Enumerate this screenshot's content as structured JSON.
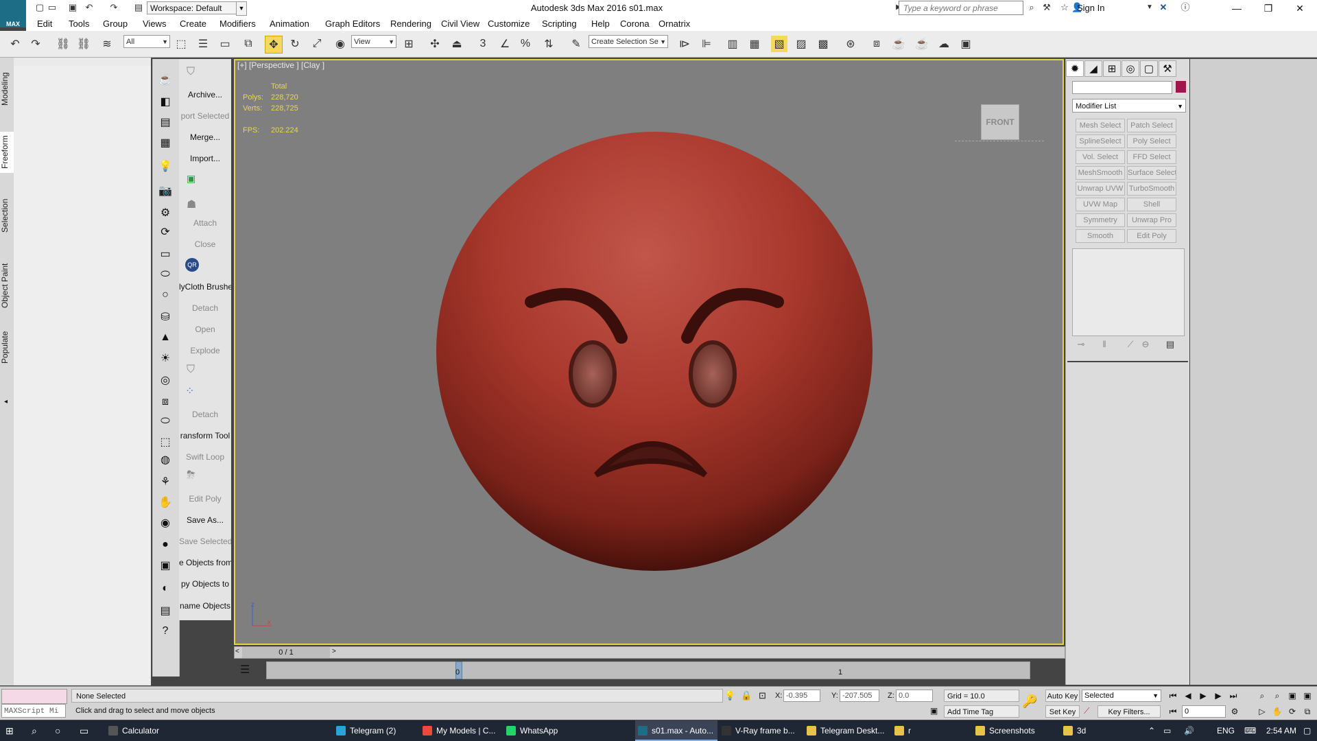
{
  "window": {
    "app_button_label": "MAX",
    "workspace": "Workspace: Default",
    "title": "Autodesk 3ds Max 2016      s01.max",
    "search_placeholder": "Type a keyword or phrase",
    "sign_in": "Sign In"
  },
  "menu": [
    "Edit",
    "Tools",
    "Group",
    "Views",
    "Create",
    "Modifiers",
    "Animation",
    "Graph Editors",
    "Rendering",
    "Civil View",
    "Customize",
    "Scripting",
    "Help",
    "Corona",
    "Ornatrix"
  ],
  "toolbar": {
    "filter": "All",
    "ref_coord": "View",
    "selection_set": "Create Selection Se"
  },
  "left_tabs": [
    "Modeling",
    "Freeform",
    "Selection",
    "Object Paint",
    "Populate"
  ],
  "command_labels": [
    {
      "text": "Archive...",
      "dim": false
    },
    {
      "text": "port Selected",
      "dim": true
    },
    {
      "text": "Merge...",
      "dim": false
    },
    {
      "text": "Import...",
      "dim": false
    },
    {
      "text": "Attach",
      "dim": true
    },
    {
      "text": "Close",
      "dim": true
    },
    {
      "text": "lyCloth Brushe",
      "dim": false
    },
    {
      "text": "Detach",
      "dim": true
    },
    {
      "text": "Open",
      "dim": true
    },
    {
      "text": "Explode",
      "dim": true
    },
    {
      "text": "Detach",
      "dim": true
    },
    {
      "text": "ransform Tool",
      "dim": false
    },
    {
      "text": "Swift Loop",
      "dim": true
    },
    {
      "text": "Edit Poly",
      "dim": true
    },
    {
      "text": "Save As...",
      "dim": false
    },
    {
      "text": "Save Selected",
      "dim": true
    },
    {
      "text": "e Objects from",
      "dim": false
    },
    {
      "text": "py Objects to",
      "dim": false
    },
    {
      "text": "name Objects",
      "dim": false
    }
  ],
  "viewport": {
    "label": "[+] [Perspective ] [Clay ]",
    "stats_header": "Total",
    "polys_label": "Polys:",
    "polys": "228,720",
    "verts_label": "Verts:",
    "verts": "228,725",
    "fps_label": "FPS:",
    "fps": "202.224",
    "viewcube": "FRONT",
    "axis_z": "z",
    "axis_x": "x"
  },
  "command_panel": {
    "modifier_list": "Modifier List",
    "swatch_color": "#a0154b",
    "modifiers": [
      "Mesh Select",
      "Patch Select",
      "SplineSelect",
      "Poly Select",
      "Vol. Select",
      "FFD Select",
      "MeshSmooth",
      "Surface Select",
      "Unwrap UVW",
      "TurboSmooth",
      "UVW Map",
      "Shell",
      "Symmetry",
      "Unwrap Pro",
      "Smooth",
      "Edit Poly"
    ]
  },
  "timeline": {
    "frame": "0 / 1",
    "tick0": "0",
    "tick1": "1"
  },
  "status": {
    "maxscript": "MAXScript Mi",
    "selection": "None Selected",
    "prompt": "Click and drag to select and move objects",
    "x_label": "X:",
    "x": "-0.395",
    "y_label": "Y:",
    "y": "-207.505",
    "z_label": "Z:",
    "z": "0.0",
    "grid": "Grid = 10.0",
    "add_time_tag": "Add Time Tag",
    "auto_key": "Auto Key",
    "set_key": "Set Key",
    "selected": "Selected",
    "key_filters": "Key Filters...",
    "current_frame": "0"
  },
  "taskbar": {
    "items": [
      "Calculator",
      "Telegram (2)",
      "My Models | C...",
      "WhatsApp",
      "s01.max - Auto...",
      "V-Ray frame b...",
      "Telegram Deskt...",
      "r",
      "Screenshots",
      "3d"
    ],
    "lang": "ENG",
    "time": "2:54 AM"
  }
}
